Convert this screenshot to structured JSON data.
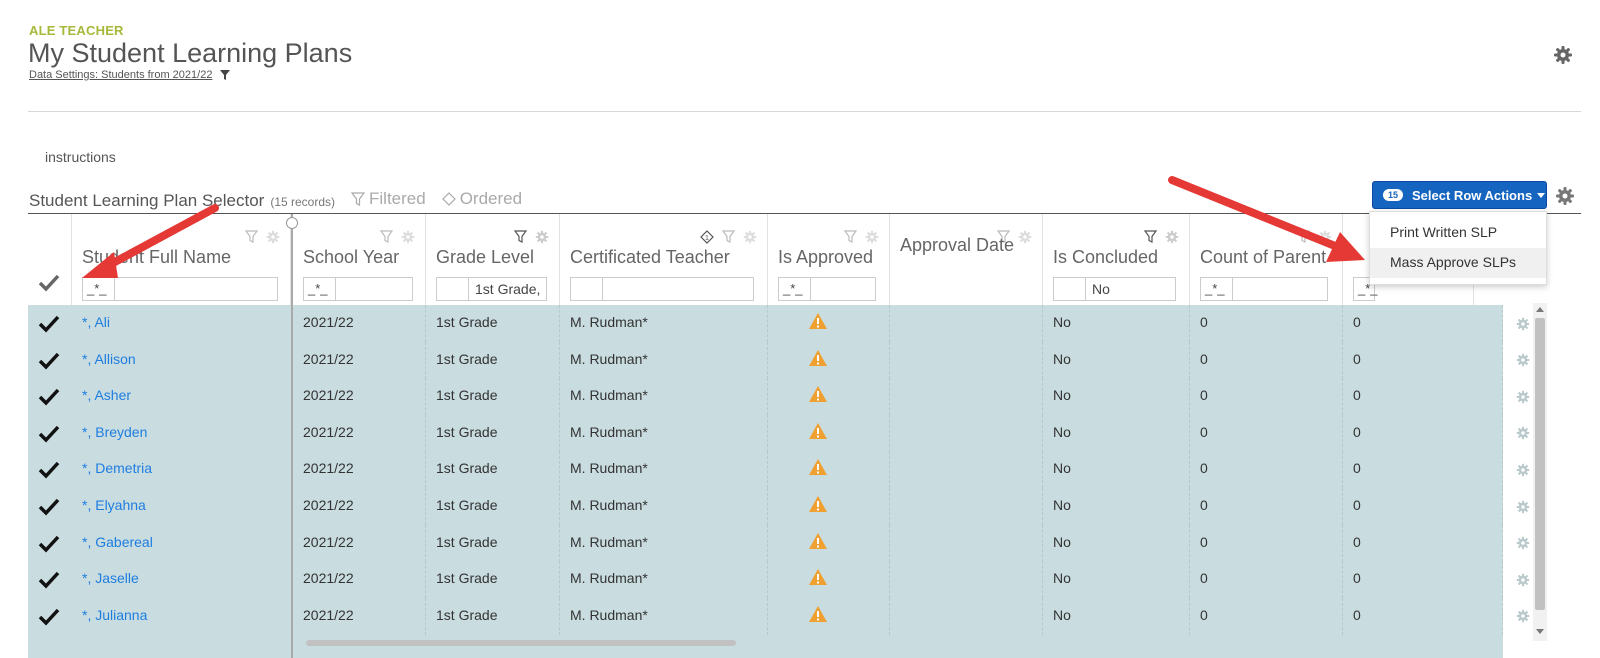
{
  "header": {
    "role": "ALE TEACHER",
    "title": "My Student Learning Plans",
    "data_settings": "Data Settings: Students from 2021/22"
  },
  "instructions": "instructions",
  "selector": {
    "title": "Student Learning Plan Selector",
    "count": "(15 records)",
    "filtered": "Filtered",
    "ordered": "Ordered"
  },
  "actions": {
    "badge": "15",
    "label": "Select Row Actions",
    "menu": [
      "Print Written SLP",
      "Mass Approve SLPs"
    ]
  },
  "columns": [
    {
      "label": "Student Full Name",
      "op": "_*_",
      "value": ""
    },
    {
      "label": "School Year",
      "op": "_*_",
      "value": ""
    },
    {
      "label": "Grade Level",
      "op": "",
      "value": "1st Grade,"
    },
    {
      "label": "Certificated Teacher",
      "op": "",
      "value": ""
    },
    {
      "label": "Is Approved",
      "op": "_*_",
      "value": ""
    },
    {
      "label": "Approval Date",
      "op": "",
      "value": ""
    },
    {
      "label": "Is Concluded",
      "op": "",
      "value": "No"
    },
    {
      "label": "Count of Parent",
      "op": "_*_",
      "value": ""
    },
    {
      "label": "",
      "op": "_*_",
      "value": ""
    }
  ],
  "rows": [
    {
      "name": "*, Ali",
      "year": "2021/22",
      "grade": "1st Grade",
      "teacher": "M. Rudman*",
      "concluded": "No",
      "count_parent": "0",
      "count_other": "0"
    },
    {
      "name": "*, Allison",
      "year": "2021/22",
      "grade": "1st Grade",
      "teacher": "M. Rudman*",
      "concluded": "No",
      "count_parent": "0",
      "count_other": "0"
    },
    {
      "name": "*, Asher",
      "year": "2021/22",
      "grade": "1st Grade",
      "teacher": "M. Rudman*",
      "concluded": "No",
      "count_parent": "0",
      "count_other": "0"
    },
    {
      "name": "*, Breyden",
      "year": "2021/22",
      "grade": "1st Grade",
      "teacher": "M. Rudman*",
      "concluded": "No",
      "count_parent": "0",
      "count_other": "0"
    },
    {
      "name": "*, Demetria",
      "year": "2021/22",
      "grade": "1st Grade",
      "teacher": "M. Rudman*",
      "concluded": "No",
      "count_parent": "0",
      "count_other": "0"
    },
    {
      "name": "*, Elyahna",
      "year": "2021/22",
      "grade": "1st Grade",
      "teacher": "M. Rudman*",
      "concluded": "No",
      "count_parent": "0",
      "count_other": "0"
    },
    {
      "name": "*, Gabereal",
      "year": "2021/22",
      "grade": "1st Grade",
      "teacher": "M. Rudman*",
      "concluded": "No",
      "count_parent": "0",
      "count_other": "0"
    },
    {
      "name": "*, Jaselle",
      "year": "2021/22",
      "grade": "1st Grade",
      "teacher": "M. Rudman*",
      "concluded": "No",
      "count_parent": "0",
      "count_other": "0"
    },
    {
      "name": "*, Julianna",
      "year": "2021/22",
      "grade": "1st Grade",
      "teacher": "M. Rudman*",
      "concluded": "No",
      "count_parent": "0",
      "count_other": "0"
    }
  ],
  "colors": {
    "role": "#a8b83a",
    "accent": "#1565c0",
    "link": "#1e7ee0",
    "row_selected": "#c9dce0",
    "warning": "#f0a030",
    "arrow": "#e53935"
  },
  "icons": {
    "settings": "gear-icon",
    "filter": "funnel-icon",
    "order": "sort-icon",
    "selected": "checkmark-icon",
    "not_approved": "warning-icon"
  }
}
